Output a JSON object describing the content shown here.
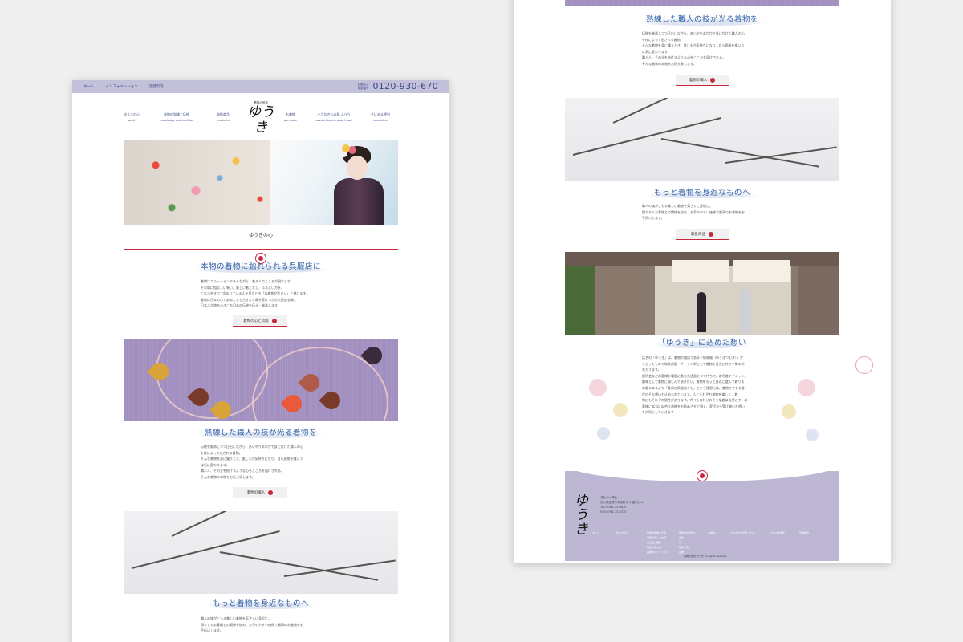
{
  "topbar": {
    "nav": [
      "ホーム",
      "インフォメーション",
      "店舗案内"
    ],
    "phone_label": "お問合せ 電話番号",
    "phone_number": "0120-930-670"
  },
  "header": {
    "logo_small": "着物の悉皆",
    "logo_text": "ゆうき",
    "nav": [
      {
        "jp": "ゆうきの心",
        "en": "spirit"
      },
      {
        "jp": "着物の知識と伝統",
        "en": "knowledge and tradition"
      },
      {
        "jp": "取扱商品",
        "en": "products"
      },
      {
        "jp": "お着物",
        "en": "purchase"
      },
      {
        "jp": "小さなきもの屋 ふらり",
        "en": "casual kimono shop fraari"
      },
      {
        "jp": "せにみま便利",
        "en": "newsletter"
      }
    ]
  },
  "left": {
    "section_label": "ゆうきの心",
    "heading1": "本物の着物に触れられる呉服店に",
    "para1": [
      "着物はファッションであるながら、着る人のこころが現れます。",
      "その場に相応しい装い、美しい着こなし、ふるまい方を、",
      "これらをすべて含まれている人を見たとき「お着物が大きい」と感じます。",
      "着物は日本の心であることと古きよき歳を受けつがれた民族衣装。",
      "日本人が誇るべきこれ日本の伝統を伝え・継承します。"
    ],
    "button1": "着物の心と伝統",
    "heading2": "熟練した職人の技が光る着物を",
    "para2": [
      "伝統を継承しつつ日出しながら、あいやり本かかで身に付けた職人の心",
      "を技によって出される着物。",
      "そんな着物を身に纏うとき、誰しもが気持ちになり、自ら居酔を纏いう",
      "は気に変わります。",
      "職人人、その全を紡げるような心をこころを届けされる。",
      "そんな着物の本物をお伝え致します。"
    ],
    "button2": "着物の職人",
    "heading3": "もっと着物を身近なものへ",
    "para3": [
      "職人の魂がこもる美しい着物を気さくに身近に。",
      "撰りすぐお客様との関係を紡め、お手のやすい価格で最高のお着物をお",
      "手伝いします。"
    ]
  },
  "right": {
    "heading_top": "熟練した職人の技が光る着物を",
    "para_top": [
      "伝統を継承しつつ日出しながら、あいやり本かかで身に付けた職人の心",
      "を技によって出される着物。",
      "そんな着物を身に纏うとき、誰しもが気持ちになり、自ら居酔を纏いう",
      "は気に変わります。",
      "職人人、その全を紡げるような心をこころを届けされる。",
      "そんな着物の本物をお伝え致します。"
    ],
    "button_top": "着物の職人",
    "heading_mid": "もっと着物を身近なものへ",
    "para_mid": [
      "職人の魂がこもる美しい着物を気さくに身近に。",
      "撰りすぐお客様との関係を紡め、お手のやすい価格で最高のお着物をお",
      "手伝いします。"
    ],
    "button_mid": "取扱商品",
    "heading_bottom": "「ゆうき」に込めた想い",
    "para_bottom": [
      "店名の「ゆうき」は、着物の雑誌である「結城紬（ゆうきつむぎ）」か",
      "らとったもので和装呉服・ギャラン単として着物を身近に作りや常の新",
      "れたうます。",
      "説明会などお客様を場面に着る先述面をつつ持ちて、着尽着やデシャン、",
      "趣味として着物に親しんで頂きたい。着物をもっと身近に選んで着りま",
      "お着る本るより「最高の呉服店でも」という理想には、着物でてもる着",
      "代のそな想いも込められています。人にそれぞれ着物を楽しく、着",
      "物にもそれぞれ個性があります。呼べも合わせのそう悩着は当然こで、お",
      "客様に本当に似合う着物をお勧めさせて頂く、変代から受け継いた想い",
      "を大切にしていきます"
    ],
    "footer": {
      "logo": "ゆうき",
      "info": [
        "きもの一師会",
        "石川県加賀市中島町ホ-1 金沢ビル",
        "TEL:0761-73-0670",
        "FAX:0761-73-6725"
      ],
      "nav_cols": [
        [
          "ホーム"
        ],
        [
          "ゆうきの心"
        ],
        [
          "着物の知識と伝統",
          "着物の美しい衣装",
          "お出掛け着物",
          "着物の手入れ",
          "着物のクリーニング"
        ],
        [
          "取扱商品の紹介",
          "着物",
          "帯",
          "和装小物",
          "反物"
        ],
        [
          "お着物"
        ],
        [
          "小さなきもの屋 ふらり"
        ],
        [
          "せにみま便利"
        ],
        [
          "店舗案内"
        ]
      ],
      "copyright": "着物の悉皆 ゆうき All rights reserved."
    }
  }
}
